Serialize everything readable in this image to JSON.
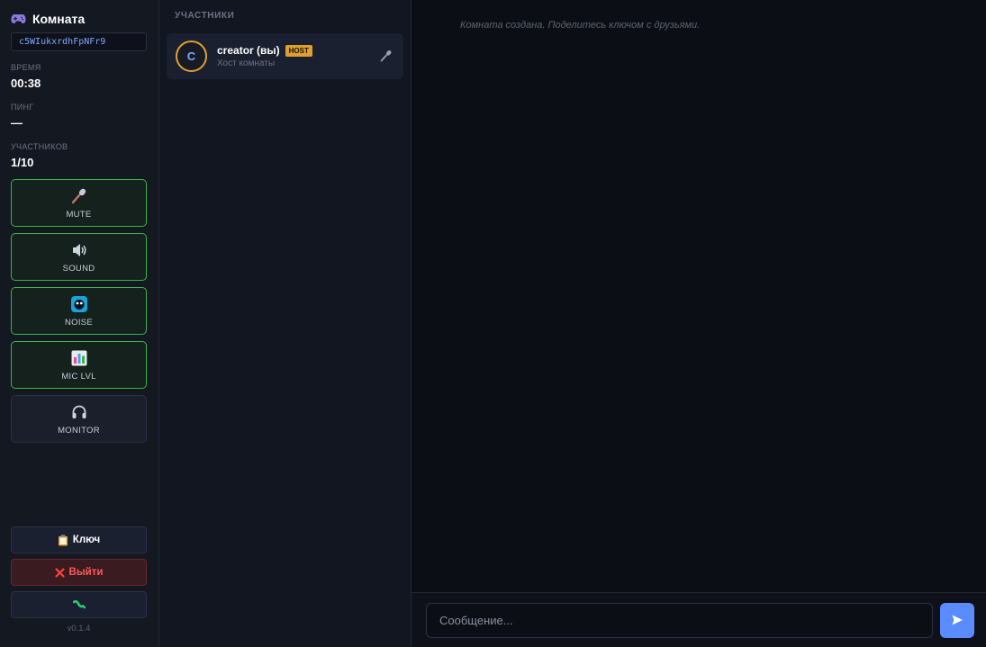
{
  "sidebar": {
    "title": "Комната",
    "room_key": "c5WIukxrdhFpNFr9",
    "stats": [
      {
        "label": "Время",
        "value": "00:38"
      },
      {
        "label": "Пинг",
        "value": "—"
      },
      {
        "label": "Участников",
        "value": "1/10"
      }
    ],
    "controls": [
      {
        "label": "MUTE",
        "icon": "microphone-icon",
        "active": true
      },
      {
        "label": "SOUND",
        "icon": "speaker-icon",
        "active": true
      },
      {
        "label": "NOISE",
        "icon": "noise-filter-icon",
        "active": true
      },
      {
        "label": "MIC LVL",
        "icon": "bar-chart-icon",
        "active": true
      },
      {
        "label": "MONITOR",
        "icon": "headphones-icon",
        "active": false
      }
    ],
    "key_button": "Ключ",
    "exit_button": "Выйти",
    "version": "v0.1.4"
  },
  "participants": {
    "title": "УЧАСТНИКИ",
    "list": [
      {
        "initial": "C",
        "name": "creator (вы)",
        "badge": "HOST",
        "role": "Хост комнаты"
      }
    ]
  },
  "chat": {
    "system_message": "Комната создана. Поделитесь ключом с друзьями.",
    "input_placeholder": "Сообщение..."
  },
  "colors": {
    "accent": "#5b8cff",
    "active_border": "#3bb54a",
    "host_badge": "#e0a030",
    "danger": "#ff5a5a"
  }
}
